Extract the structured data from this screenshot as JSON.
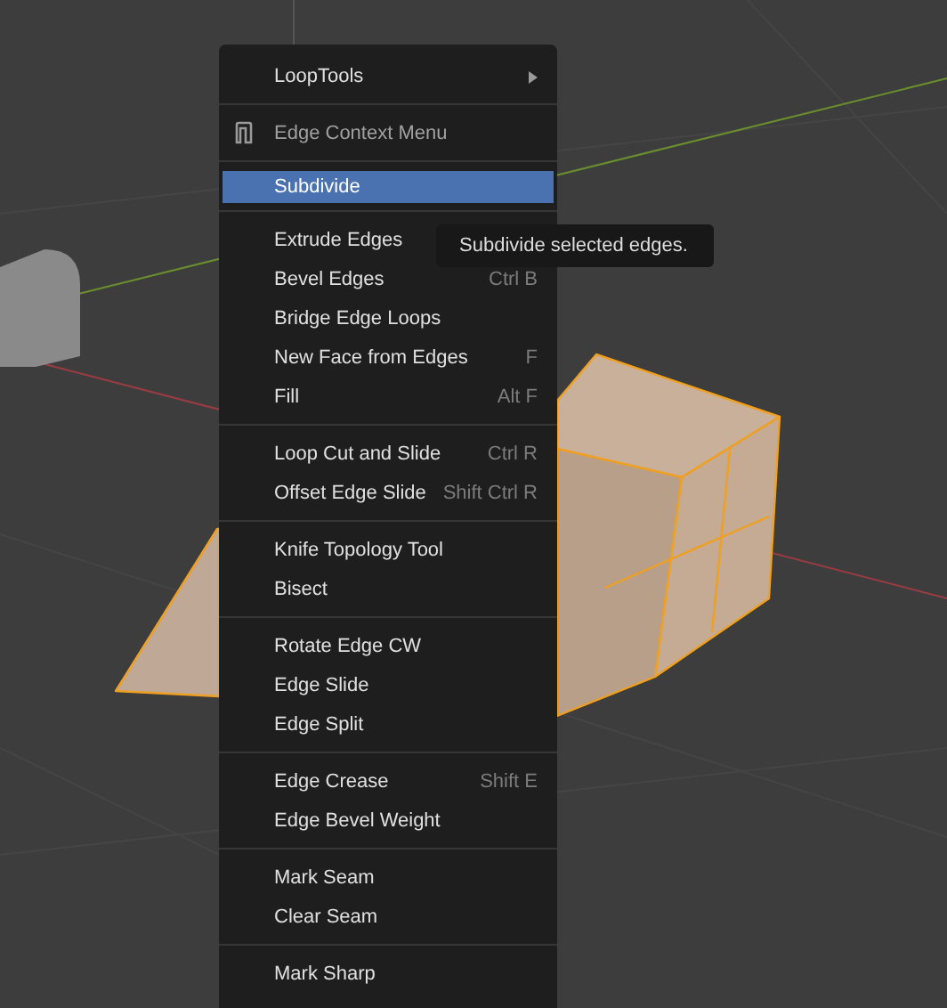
{
  "menu": {
    "sections": [
      {
        "items": [
          {
            "kind": "submenu",
            "label": "LoopTools",
            "selected": false
          }
        ]
      },
      {
        "items": [
          {
            "kind": "header",
            "label": "Edge Context Menu",
            "selected": false
          }
        ]
      },
      {
        "items": [
          {
            "kind": "command",
            "label": "Subdivide",
            "selected": true
          }
        ]
      },
      {
        "items": [
          {
            "kind": "command",
            "label": "Extrude Edges",
            "selected": false
          },
          {
            "kind": "command",
            "label": "Bevel Edges",
            "shortcut": "Ctrl B",
            "selected": false
          },
          {
            "kind": "command",
            "label": "Bridge Edge Loops",
            "selected": false
          },
          {
            "kind": "command",
            "label": "New Face from Edges",
            "shortcut": "F",
            "selected": false
          },
          {
            "kind": "command",
            "label": "Fill",
            "shortcut": "Alt F",
            "selected": false
          }
        ]
      },
      {
        "items": [
          {
            "kind": "command",
            "label": "Loop Cut and Slide",
            "shortcut": "Ctrl R",
            "selected": false
          },
          {
            "kind": "command",
            "label": "Offset Edge Slide",
            "shortcut": "Shift Ctrl R",
            "selected": false
          }
        ]
      },
      {
        "items": [
          {
            "kind": "command",
            "label": "Knife Topology Tool",
            "selected": false
          },
          {
            "kind": "command",
            "label": "Bisect",
            "selected": false
          }
        ]
      },
      {
        "items": [
          {
            "kind": "command",
            "label": "Rotate Edge CW",
            "selected": false
          },
          {
            "kind": "command",
            "label": "Edge Slide",
            "selected": false
          },
          {
            "kind": "command",
            "label": "Edge Split",
            "selected": false
          }
        ]
      },
      {
        "items": [
          {
            "kind": "command",
            "label": "Edge Crease",
            "shortcut": "Shift E",
            "selected": false
          },
          {
            "kind": "command",
            "label": "Edge Bevel Weight",
            "selected": false
          }
        ]
      },
      {
        "items": [
          {
            "kind": "command",
            "label": "Mark Seam",
            "selected": false
          },
          {
            "kind": "command",
            "label": "Clear Seam",
            "selected": false
          }
        ]
      },
      {
        "items": [
          {
            "kind": "command",
            "label": "Mark Sharp",
            "selected": false
          }
        ]
      }
    ]
  },
  "tooltip": {
    "text": "Subdivide selected edges."
  }
}
